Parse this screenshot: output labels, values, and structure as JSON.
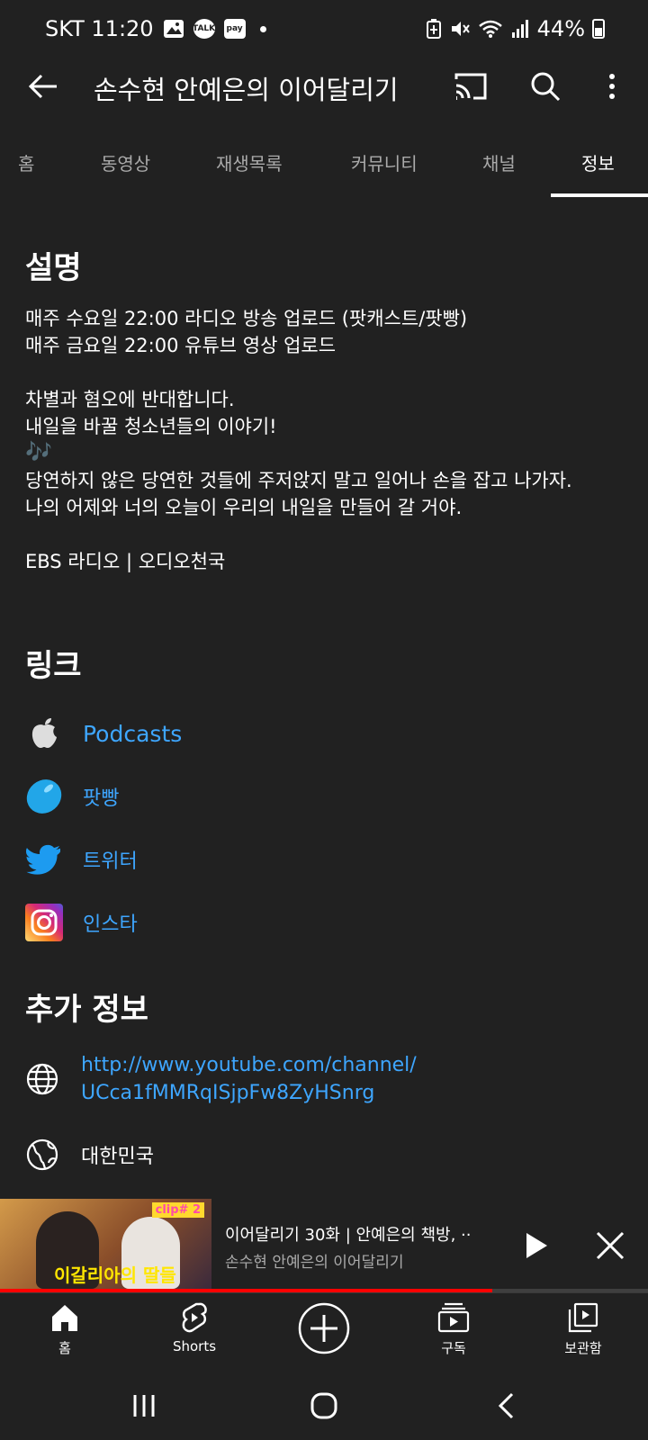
{
  "status_bar": {
    "carrier_time": "SKT 11:20",
    "talk_label": "TALK",
    "pay_label": "pay",
    "battery": "44%"
  },
  "app_bar": {
    "title": "손수현 안예은의 이어달리기"
  },
  "tabs": [
    {
      "label": "홈"
    },
    {
      "label": "동영상"
    },
    {
      "label": "재생목록"
    },
    {
      "label": "커뮤니티"
    },
    {
      "label": "채널"
    },
    {
      "label": "정보"
    }
  ],
  "description": {
    "title": "설명",
    "lines": [
      "매주 수요일 22:00 라디오 방송 업로드 (팟캐스트/팟빵)",
      "매주 금요일 22:00 유튜브 영상 업로드",
      "차별과 혐오에 반대합니다.",
      "내일을 바꿀 청소년들의 이야기!",
      "당연하지 않은 당연한 것들에 주저앉지 말고 일어나 손을 잡고 나가자.",
      "나의 어제와 너의 오늘이 우리의 내일을 만들어 갈 거야.",
      "EBS 라디오 | 오디오천국"
    ],
    "music_note": "🎶"
  },
  "links": {
    "title": "링크",
    "items": [
      {
        "label": "Podcasts",
        "icon": "apple-icon"
      },
      {
        "label": "팟빵",
        "icon": "bean-icon"
      },
      {
        "label": "트위터",
        "icon": "twitter-icon"
      },
      {
        "label": "인스타",
        "icon": "instagram-icon"
      }
    ]
  },
  "additional_info": {
    "title": "추가 정보",
    "url_line1": "http://www.youtube.com/channel/",
    "url_line2": "UCca1fMMRqISjpFw8ZyHSnrg",
    "country": "대한민국"
  },
  "mini_player": {
    "title": "이어달리기 30화 | 안예은의 책방, ··",
    "channel": "손수현 안예은의 이어달리기",
    "thumb_clip": "clip# 2",
    "thumb_caption": "이갈리아의 딸들",
    "progress_fraction": 0.76
  },
  "bottom_nav": [
    {
      "label": "홈",
      "icon": "home-icon"
    },
    {
      "label": "Shorts",
      "icon": "shorts-icon"
    },
    {
      "label": "",
      "icon": "create-icon"
    },
    {
      "label": "구독",
      "icon": "subscriptions-icon"
    },
    {
      "label": "보관함",
      "icon": "library-icon"
    }
  ],
  "colors": {
    "background": "#212121",
    "link_blue": "#3ea6ff",
    "progress_red": "#ff0000",
    "muted_text": "#aaaaaa"
  }
}
